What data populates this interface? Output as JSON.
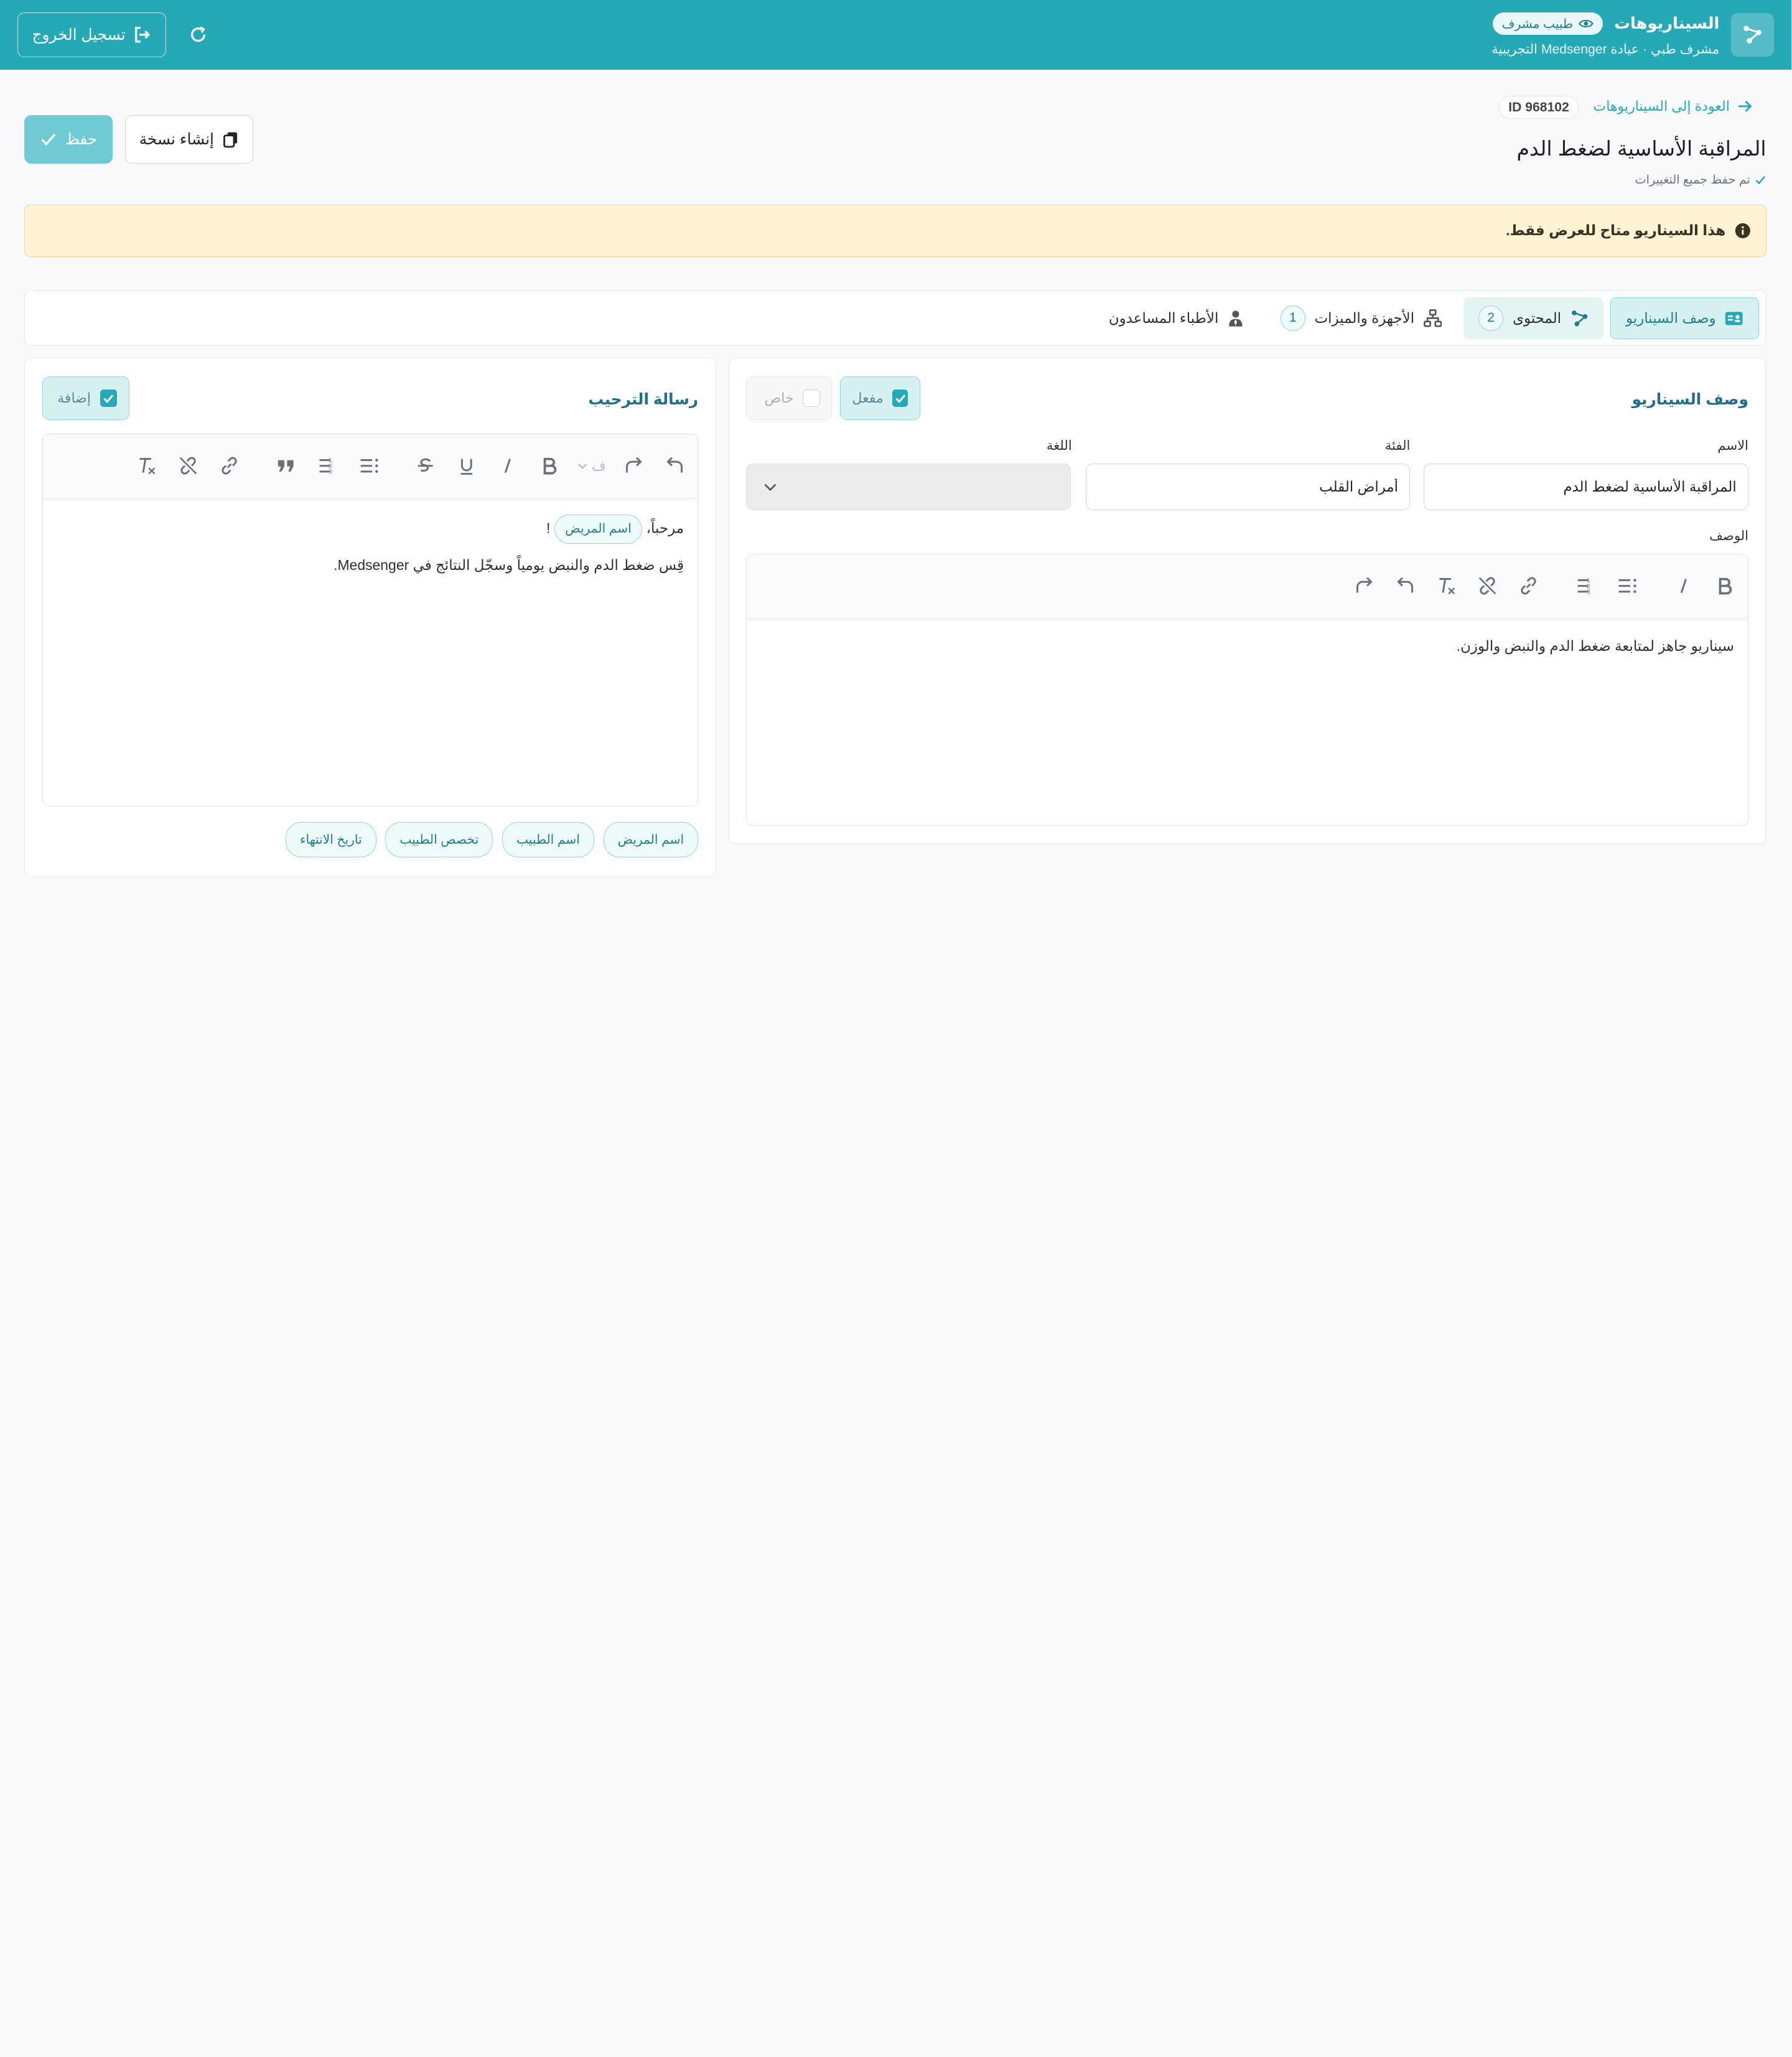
{
  "header": {
    "title": "السيناريوهات",
    "role_badge": "طبيب مشرف",
    "subtitle": "مشرف طبي · عيادة Medsenger التجريبية",
    "logout_label": "تسجيل الخروج"
  },
  "page": {
    "back_label": "العودة إلى السيناريوهات",
    "id_badge": "ID 968102",
    "title": "المراقبة الأساسية لضغط الدم",
    "saved_note": "تم حفظ جميع التغييرات",
    "save_label": "حفظ",
    "copy_label": "إنشاء نسخة"
  },
  "alert": {
    "text": "هذا السيناريو متاح للعرض فقط."
  },
  "tabs": [
    {
      "label": "وصف السيناريو",
      "icon": "id-card-icon"
    },
    {
      "label": "المحتوى",
      "count": "2",
      "icon": "workflow-icon"
    },
    {
      "label": "الأجهزة والميزات",
      "count": "1",
      "icon": "network-icon"
    },
    {
      "label": "الأطباء المساعدون",
      "icon": "user-tie-icon"
    }
  ],
  "description_panel": {
    "title": "وصف السيناريو",
    "enabled_label": "مفعل",
    "enabled": true,
    "private_label": "خاص",
    "private": false,
    "name_label": "الاسم",
    "name_value": "المراقبة الأساسية لضغط الدم",
    "category_label": "الفئة",
    "category_value": "أمراض القلب",
    "language_label": "اللغة",
    "language_value": "",
    "description_label": "الوصف",
    "description_text": "سيناريو جاهز لمتابعة ضغط الدم والنبض والوزن."
  },
  "welcome_panel": {
    "title": "رسالة الترحيب",
    "add_label": "إضافة",
    "add_checked": true,
    "heading_dd": "ف",
    "greeting": "مرحباً،",
    "greeting_var": "اسم المريض",
    "greeting_end": "!",
    "body_line": "قِس ضغط الدم والنبض يومياً وسجّل النتائج في Medsenger.",
    "variables": [
      "اسم المريض",
      "اسم الطبيب",
      "تخصص الطبيب",
      "تاريخ الانتهاء"
    ]
  },
  "colors": {
    "brand": "#26a9b6",
    "accent_light": "#d7f1f3",
    "alert_bg": "#fff3d6",
    "title_blue": "#1f6f8b"
  }
}
